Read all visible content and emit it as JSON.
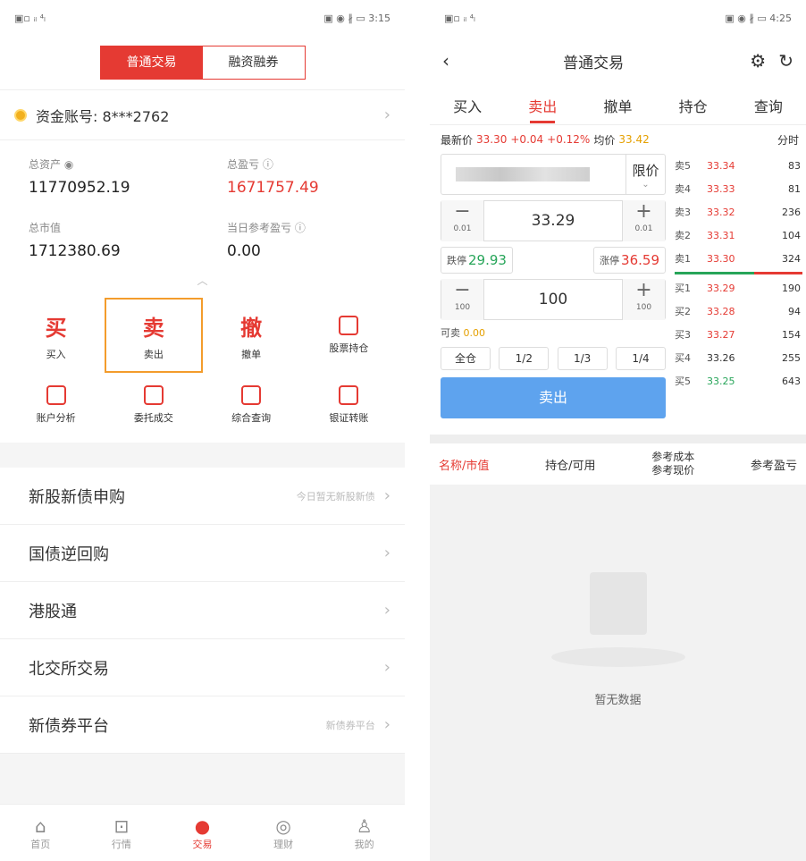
{
  "left": {
    "status": {
      "icons": "▣▫ ᵢₗ ⁴ₗ",
      "right": "▣ ◉ ∦ ▭ 3:15"
    },
    "segment": {
      "tab1": "普通交易",
      "tab2": "融资融券"
    },
    "account": {
      "label": "资金账号: 8***2762"
    },
    "assets": [
      {
        "label": "总资产 ◉",
        "value": "11770952.19"
      },
      {
        "label": "总盈亏 ⓘ",
        "value": "1671757.49"
      },
      {
        "label": "总市值",
        "value": "1712380.69"
      },
      {
        "label": "当日参考盈亏 ⓘ",
        "value": "0.00"
      }
    ],
    "actions": [
      {
        "big": "买",
        "label": "买入"
      },
      {
        "big": "卖",
        "label": "卖出"
      },
      {
        "big": "撤",
        "label": "撤单"
      },
      {
        "label": "股票持仓"
      },
      {
        "label": "账户分析"
      },
      {
        "label": "委托成交"
      },
      {
        "label": "综合查询"
      },
      {
        "label": "银证转账"
      }
    ],
    "list": [
      {
        "label": "新股新债申购",
        "hint": "今日暂无新股新债"
      },
      {
        "label": "国债逆回购",
        "hint": ""
      },
      {
        "label": "港股通",
        "hint": ""
      },
      {
        "label": "北交所交易",
        "hint": ""
      },
      {
        "label": "新债券平台",
        "hint": "新债券平台"
      }
    ],
    "tabs": [
      "首页",
      "行情",
      "交易",
      "理财",
      "我的"
    ]
  },
  "right": {
    "status": {
      "icons": "▣▫ ᵢₗ ⁴ₗ",
      "right": "▣ ◉ ∦ ▭ 4:25"
    },
    "title": "普通交易",
    "tabs": [
      "买入",
      "卖出",
      "撤单",
      "持仓",
      "查询"
    ],
    "quote": {
      "label": "最新价",
      "price": "33.30",
      "chg": "+0.04",
      "pct": "+0.12%",
      "avg_label": "均价",
      "avg": "33.42",
      "mode": "分时"
    },
    "order_type": "限价",
    "price": {
      "value": "33.29",
      "step": "0.01"
    },
    "limit_down": {
      "label": "跌停",
      "value": "29.93"
    },
    "limit_up": {
      "label": "涨停",
      "value": "36.59"
    },
    "qty": {
      "value": "100",
      "step": "100"
    },
    "available": {
      "label": "可卖",
      "value": "0.00"
    },
    "ratios": [
      "全仓",
      "1/2",
      "1/3",
      "1/4"
    ],
    "sell_button": "卖出",
    "asks": [
      {
        "level": "卖5",
        "price": "33.34",
        "vol": "83"
      },
      {
        "level": "卖4",
        "price": "33.33",
        "vol": "81"
      },
      {
        "level": "卖3",
        "price": "33.32",
        "vol": "236"
      },
      {
        "level": "卖2",
        "price": "33.31",
        "vol": "104"
      },
      {
        "level": "卖1",
        "price": "33.30",
        "vol": "324"
      }
    ],
    "bids": [
      {
        "level": "买1",
        "price": "33.29",
        "vol": "190"
      },
      {
        "level": "买2",
        "price": "33.28",
        "vol": "94"
      },
      {
        "level": "买3",
        "price": "33.27",
        "vol": "154"
      },
      {
        "level": "买4",
        "price": "33.26",
        "vol": "255"
      },
      {
        "level": "买5",
        "price": "33.25",
        "vol": "643"
      }
    ],
    "columns": {
      "c1": "名称/市值",
      "c2": "持仓/可用",
      "c3a": "参考成本",
      "c3b": "参考现价",
      "c4": "参考盈亏"
    },
    "empty_text": "暂无数据"
  }
}
